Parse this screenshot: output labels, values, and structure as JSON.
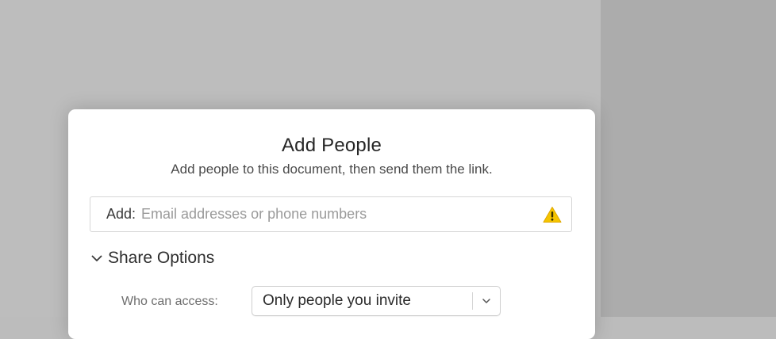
{
  "dialog": {
    "title": "Add People",
    "subtitle": "Add people to this document, then send them the link."
  },
  "add_field": {
    "label": "Add:",
    "placeholder": "Email addresses or phone numbers",
    "value": "",
    "status_icon": "warning-icon",
    "status_color": "#f5c400"
  },
  "share_options": {
    "label": "Share Options",
    "expanded": true,
    "icon": "chevron-down-icon"
  },
  "access": {
    "label": "Who can access:",
    "selected": "Only people you invite",
    "icon": "chevron-down-icon"
  }
}
